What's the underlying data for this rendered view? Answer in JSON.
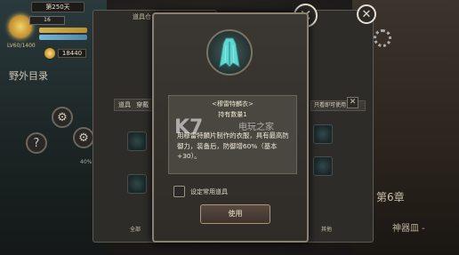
{
  "hud": {
    "day": "第250天",
    "level": "16",
    "exp": "LV60/1400",
    "gold": "18440"
  },
  "left": {
    "field_directory": "野外目录",
    "help_icon": "?",
    "percent": "40%"
  },
  "back_panel": {
    "title": "道具仓",
    "tabs": [
      "道具",
      "穿戴"
    ],
    "bottom_left": "全部",
    "bottom_right": "其他",
    "right_tab": "只看即可使用"
  },
  "popup": {
    "item_name": "<穆雷特麟衣>",
    "count": "持有数量1",
    "description": "用穆雷特麟片制作的衣服，具有最高防御力，装备后，防御增60%（基本+30）。",
    "checkbox_label": "设定常用道具",
    "use_button": "使用"
  },
  "right": {
    "chapter": "第6章",
    "chapter_sub": "神器皿 -"
  },
  "watermark": {
    "main": "K7",
    "sub": "电玩之家"
  }
}
